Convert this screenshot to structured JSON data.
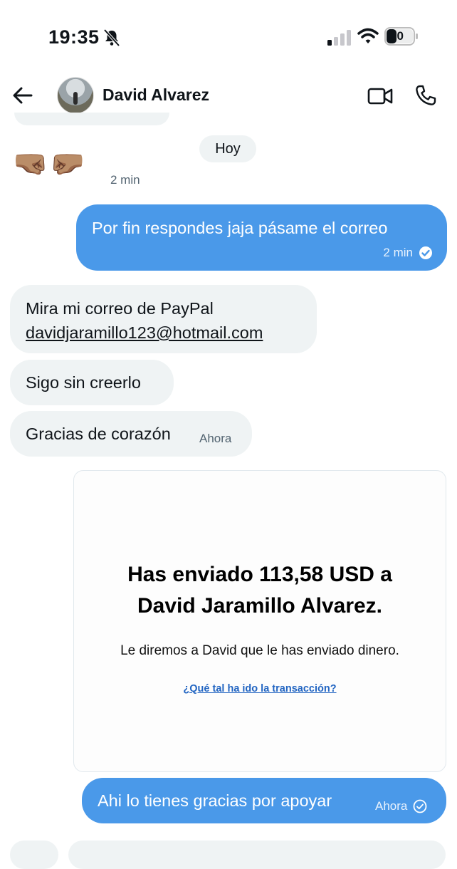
{
  "status_bar": {
    "time": "19:35",
    "battery": "30",
    "icons": [
      "bell-slash-icon",
      "signal-icon",
      "wifi-icon",
      "battery-icon"
    ]
  },
  "header": {
    "contact_name": "David Alvarez",
    "icons": [
      "back-arrow-icon",
      "video-call-icon",
      "phone-icon"
    ]
  },
  "conversation": {
    "day_separator": "Hoy",
    "emoji_message": {
      "text": "🤜🏽🤛🏽",
      "timestamp": "2 min"
    },
    "messages": [
      {
        "side": "out",
        "text": "Por fin respondes jaja pásame el correo",
        "timestamp": "2 min"
      },
      {
        "side": "in",
        "line1": "Mira mi correo de PayPal",
        "line2": "davidjaramillo123@hotmail.com"
      },
      {
        "side": "in",
        "text": "Sigo sin creerlo"
      },
      {
        "side": "in",
        "text": "Gracias de corazón",
        "timestamp": "Ahora"
      }
    ],
    "image_card": {
      "title_line1": "Has enviado 113,58  USD a",
      "title_line2": "David Jaramillo Alvarez.",
      "subtitle": "Le diremos a David que le has enviado dinero.",
      "link": "¿Qué tal ha ido la transacción?"
    },
    "last_message": {
      "side": "out",
      "text": "Ahi lo tienes gracias por apoyar",
      "timestamp": "Ahora"
    }
  },
  "colors": {
    "outgoing_bubble": "#4a99e9",
    "incoming_bubble": "#eff3f4",
    "link": "#2265c2"
  }
}
